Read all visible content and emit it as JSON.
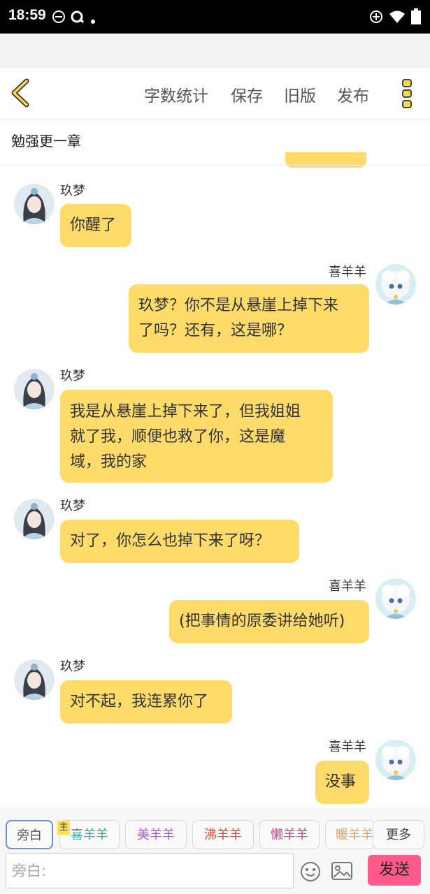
{
  "status_bar": {
    "time": "18:59"
  },
  "toolbar": {
    "word_count": "字数统计",
    "save": "保存",
    "old_version": "旧版",
    "publish": "发布"
  },
  "chapter_title": "勉强更一章",
  "messages": [
    {
      "sender": "玖梦",
      "text": "你醒了"
    },
    {
      "sender": "喜羊羊",
      "text_line1": "玖梦？你不是从悬崖上掉下来",
      "text_line2": "了吗？还有，这是哪？"
    },
    {
      "sender": "玖梦",
      "text_line1": "我是从悬崖上掉下来了，但我姐姐",
      "text_line2": "就了我，顺便也救了你，这是魔",
      "text_line3": "域，我的家"
    },
    {
      "sender": "玖梦",
      "text": "对了，你怎么也掉下来了呀？"
    },
    {
      "sender": "喜羊羊",
      "text": "(把事情的原委讲给她听)"
    },
    {
      "sender": "玖梦",
      "text": "对不起，我连累你了"
    },
    {
      "sender": "喜羊羊",
      "text": "没事"
    }
  ],
  "roles": {
    "narration": "旁白",
    "host_badge": "主",
    "r1": "喜羊羊",
    "r2": "美羊羊",
    "r3": "沸羊羊",
    "r4": "懒羊羊",
    "r5": "暖羊羊",
    "more": "更多"
  },
  "role_colors": {
    "r1": "#2bb3a3",
    "r2": "#b15ad6",
    "r3": "#e0483c",
    "r4": "#d6418a",
    "r5": "#f0a25a"
  },
  "input": {
    "placeholder": "旁白:"
  },
  "send_label": "发送"
}
